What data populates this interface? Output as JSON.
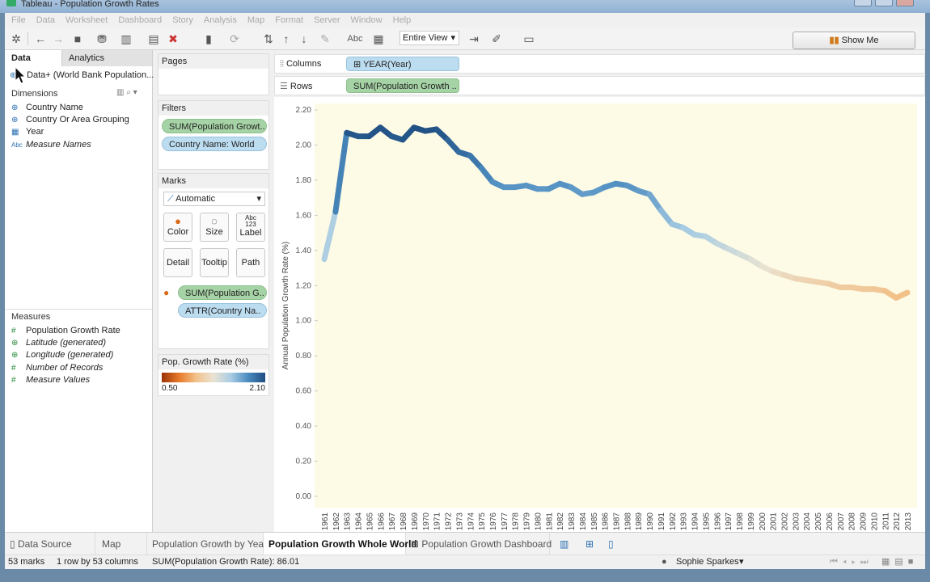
{
  "window": {
    "title": "Tableau - Population Growth Rates"
  },
  "menu": [
    "File",
    "Data",
    "Worksheet",
    "Dashboard",
    "Story",
    "Analysis",
    "Map",
    "Format",
    "Server",
    "Window",
    "Help"
  ],
  "toolbar": {
    "fit_select": "Entire View",
    "show_me": "Show Me",
    "abc_label": "Abc"
  },
  "left_pane": {
    "tabs": {
      "data": "Data",
      "analytics": "Analytics"
    },
    "datasource": "Data+ (World Bank Population...",
    "dimensions_title": "Dimensions",
    "dimensions": [
      {
        "label": "Country Name",
        "icon": "globe-icon",
        "italic": false
      },
      {
        "label": "Country Or Area Grouping",
        "icon": "globe-icon",
        "italic": false
      },
      {
        "label": "Year",
        "icon": "calendar-icon",
        "italic": false
      },
      {
        "label": "Measure Names",
        "icon": "abc-icon",
        "italic": true
      }
    ],
    "measures_title": "Measures",
    "measures": [
      {
        "label": "Population Growth Rate",
        "icon": "hash-icon",
        "italic": false
      },
      {
        "label": "Latitude (generated)",
        "icon": "globe-icon",
        "italic": true
      },
      {
        "label": "Longitude (generated)",
        "icon": "globe-icon",
        "italic": true
      },
      {
        "label": "Number of Records",
        "icon": "hash-icon",
        "italic": true
      },
      {
        "label": "Measure Values",
        "icon": "hash-icon",
        "italic": true
      }
    ]
  },
  "mid_pane": {
    "pages_title": "Pages",
    "filters_title": "Filters",
    "filters": [
      "SUM(Population Growt..",
      "Country Name: World"
    ],
    "marks_title": "Marks",
    "mark_type": "Automatic",
    "mark_buttons": {
      "color": "Color",
      "size": "Size",
      "label": "Label",
      "detail": "Detail",
      "tooltip": "Tooltip",
      "path": "Path"
    },
    "mark_pills": [
      "SUM(Population G..",
      "ATTR(Country Na.."
    ],
    "legend": {
      "title": "Pop. Growth Rate (%)",
      "min": "0.50",
      "max": "2.10"
    }
  },
  "shelves": {
    "columns_label": "Columns",
    "columns_pill": "YEAR(Year)",
    "rows_label": "Rows",
    "rows_pill": "SUM(Population Growth .."
  },
  "sheet_tabs": {
    "datasource": "Data Source",
    "tabs": [
      "Map",
      "Population Growth by Year",
      "Population Growth Whole World",
      "Population Growth Dashboard"
    ],
    "active": "Population Growth Whole World"
  },
  "status": {
    "marks": "53 marks",
    "dims": "1 row by 53 columns",
    "sum": "SUM(Population Growth Rate): 86.01",
    "user": "Sophie Sparkes"
  },
  "colors": {
    "low": "#b94a10",
    "mid": "#e8e2d0",
    "high": "#1f4e82",
    "background": "#fdfbe6"
  },
  "chart_data": {
    "type": "line",
    "ylabel": "Annual Population Growth Rate (%)",
    "xlabel": "",
    "ylim": [
      0,
      2.2
    ],
    "y_ticks": [
      "0.00",
      "0.20",
      "0.40",
      "0.60",
      "0.80",
      "1.00",
      "1.20",
      "1.40",
      "1.60",
      "1.80",
      "2.00",
      "2.20"
    ],
    "x": [
      1961,
      1962,
      1963,
      1964,
      1965,
      1966,
      1967,
      1968,
      1969,
      1970,
      1971,
      1972,
      1973,
      1974,
      1975,
      1976,
      1977,
      1978,
      1979,
      1980,
      1981,
      1982,
      1983,
      1984,
      1985,
      1986,
      1987,
      1988,
      1989,
      1990,
      1991,
      1992,
      1993,
      1994,
      1995,
      1996,
      1997,
      1998,
      1999,
      2000,
      2001,
      2002,
      2003,
      2004,
      2005,
      2006,
      2007,
      2008,
      2009,
      2010,
      2011,
      2012,
      2013
    ],
    "values": [
      1.35,
      1.62,
      2.07,
      2.05,
      2.05,
      2.1,
      2.05,
      2.03,
      2.1,
      2.08,
      2.09,
      2.03,
      1.96,
      1.94,
      1.87,
      1.79,
      1.76,
      1.76,
      1.77,
      1.75,
      1.75,
      1.78,
      1.76,
      1.72,
      1.73,
      1.76,
      1.78,
      1.77,
      1.74,
      1.72,
      1.63,
      1.55,
      1.53,
      1.49,
      1.48,
      1.44,
      1.41,
      1.38,
      1.35,
      1.31,
      1.28,
      1.26,
      1.24,
      1.23,
      1.22,
      1.21,
      1.19,
      1.19,
      1.18,
      1.18,
      1.17,
      1.13,
      1.16
    ],
    "color_legend": {
      "min": 0.5,
      "max": 2.1
    },
    "grid": false
  }
}
